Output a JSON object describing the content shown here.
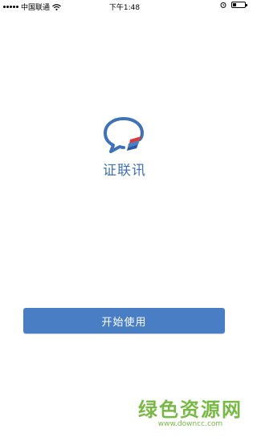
{
  "status_bar": {
    "carrier": "中国联通",
    "time": "下午1:48",
    "battery_level": 0.3,
    "icons": [
      "signal-icon",
      "wifi-icon",
      "alarm-icon",
      "battery-icon"
    ]
  },
  "app": {
    "name": "证联讯",
    "logo_icon": "chat-bubble-logo-icon",
    "brand_color": "#3f72b6",
    "accent_color": "#d93a3a"
  },
  "actions": {
    "start_label": "开始使用",
    "start_color": "#4a7ec4"
  },
  "watermark": {
    "title": "绿色资源网",
    "url": "www.downcc.com",
    "color": "#78b845"
  }
}
